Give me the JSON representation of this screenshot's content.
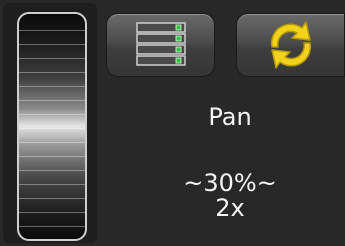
{
  "colors": {
    "background": "#282828",
    "text": "#f4f4f4",
    "accent_yellow": "#f2d21a",
    "indicator_green": "#39c24a"
  },
  "jog_wheel": {
    "icon": "jog-wheel"
  },
  "toolbar": {
    "server_button_icon": "server-rack-icon",
    "refresh_button_icon": "refresh-arrows-icon"
  },
  "status": {
    "mode": "Pan",
    "percent": "~30%~",
    "speed": "2x"
  }
}
